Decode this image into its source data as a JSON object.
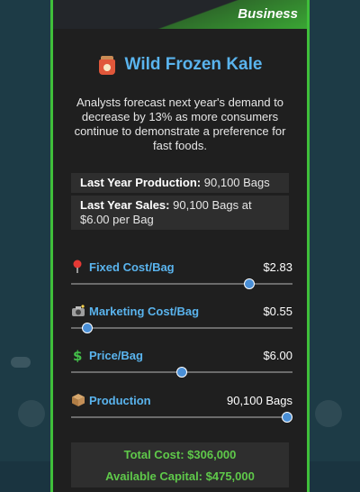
{
  "modal": {
    "tag": "Business",
    "title": "Wild Frozen Kale",
    "description": "Analysts forecast next year's demand to decrease by 13% as more consumers continue to demonstrate a preference for fast foods.",
    "last_year_production_label": "Last Year Production:",
    "last_year_production_value": "90,100 Bags",
    "last_year_sales_label": "Last Year Sales:",
    "last_year_sales_value": "90,100 Bags at $6.00 per Bag",
    "sliders": [
      {
        "label": "Fixed Cost/Bag",
        "value": "$2.83",
        "icon": "pin-icon",
        "level": 0.82
      },
      {
        "label": "Marketing Cost/Bag",
        "value": "$0.55",
        "icon": "camera-icon",
        "level": 0.05
      },
      {
        "label": "Price/Bag",
        "value": "$6.00",
        "icon": "dollar-icon",
        "level": 0.5
      },
      {
        "label": "Production",
        "value": "90,100 Bags",
        "icon": "box-icon",
        "level": 1.0
      }
    ],
    "total_cost_label": "Total Cost:",
    "total_cost_value": "$306,000",
    "available_capital_label": "Available Capital:",
    "available_capital_value": "$475,000"
  },
  "colors": {
    "accent_green": "#3fbf3a",
    "label_blue": "#5ab4ee",
    "summary_green": "#5fc94a",
    "knob_blue": "#4a8fd6"
  }
}
